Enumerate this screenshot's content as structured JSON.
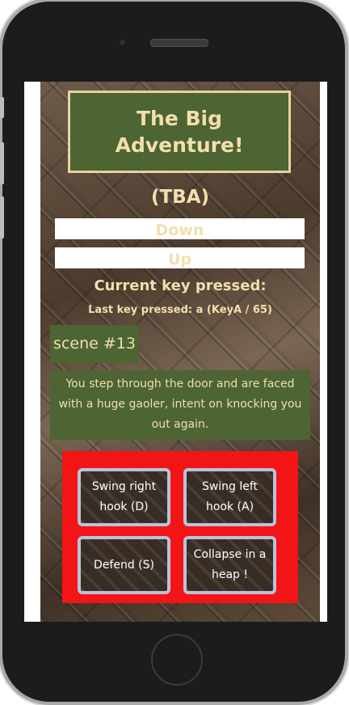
{
  "game": {
    "title": "The Big Adventure!",
    "status": "(TBA)",
    "buttons": {
      "down": "Down",
      "up": "Up"
    },
    "key": {
      "heading": "Current key pressed:",
      "last": "Last key pressed: a (KeyA / 65)"
    },
    "scene": "scene #13",
    "narrative": "You step through the door and are faced with a huge gaoler, intent on knocking you out again.",
    "choices": [
      {
        "label": "Swing right hook (D)"
      },
      {
        "label": "Swing left hook (A)"
      },
      {
        "label": "Defend (S)"
      },
      {
        "label": "Collapse in a heap !"
      }
    ]
  },
  "colors": {
    "panel_green": "#4d6433",
    "accent_cream": "#f2dfad",
    "choices_bg": "#f31515",
    "choice_border": "#b9c2da"
  }
}
